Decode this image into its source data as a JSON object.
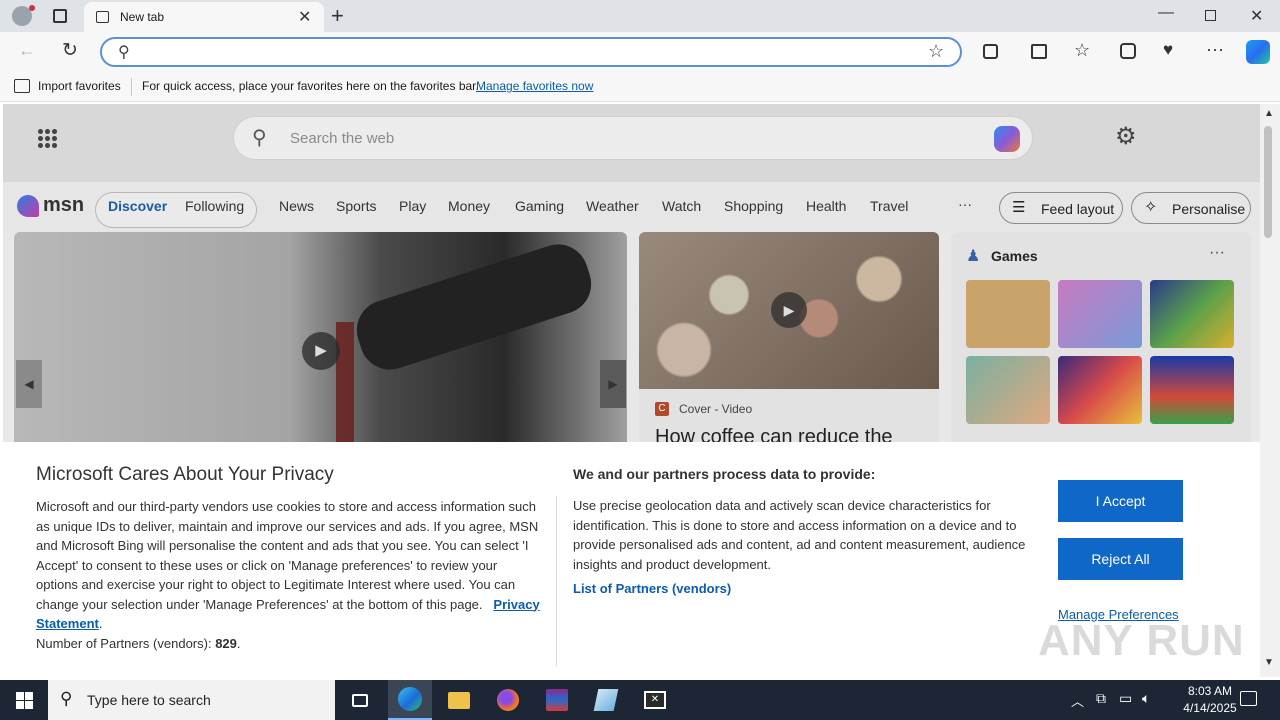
{
  "browser": {
    "tab_title": "New tab",
    "address_value": "",
    "favorites": {
      "import_label": "Import favorites",
      "hint": "For quick access, place your favorites here on the favorites bar.",
      "manage_link": "Manage favorites now"
    }
  },
  "msn": {
    "search_placeholder": "Search the web",
    "logo": "msn",
    "tabs": [
      "Discover",
      "Following"
    ],
    "nav": [
      "News",
      "Sports",
      "Play",
      "Money",
      "Gaming",
      "Weather",
      "Watch",
      "Shopping",
      "Health",
      "Travel"
    ],
    "more": "···",
    "feed_layout": "Feed layout",
    "personalise": "Personalise",
    "story": {
      "source": "Cover - Video",
      "source_badge": "C",
      "headline": "How coffee can reduce the"
    },
    "games_title": "Games"
  },
  "privacy": {
    "title": "Microsoft Cares About Your Privacy",
    "body": "Microsoft and our third-party vendors use cookies to store and access information such as unique IDs to deliver, maintain and improve our services and ads. If you agree, MSN and Microsoft Bing will personalise the content and ads that you see. You can select 'I Accept' to consent to these uses or click on 'Manage preferences' to review your options and exercise your right to object to Legitimate Interest where used.  You can change your selection under 'Manage Preferences' at the bottom of this page.",
    "privacy_link": "Privacy Statement",
    "partners_label": "Number of Partners (vendors):",
    "partners_count": "829",
    "process_title": "We and our partners process data to provide:",
    "process_body": "Use precise geolocation data and actively scan device characteristics for identification. This is done to store and access information on a device and to provide personalised ads and content, ad and content measurement, audience insights and product development.",
    "vendors_link": "List of Partners (vendors)",
    "accept": "I Accept",
    "reject": "Reject All",
    "manage": "Manage Preferences"
  },
  "watermark": "ANY RUN",
  "taskbar": {
    "search_placeholder": "Type here to search",
    "time": "8:03 AM",
    "date": "4/14/2025"
  },
  "colors": {
    "accent": "#0f67c8",
    "link": "#0b5cad",
    "taskbar": "#1d2634"
  }
}
